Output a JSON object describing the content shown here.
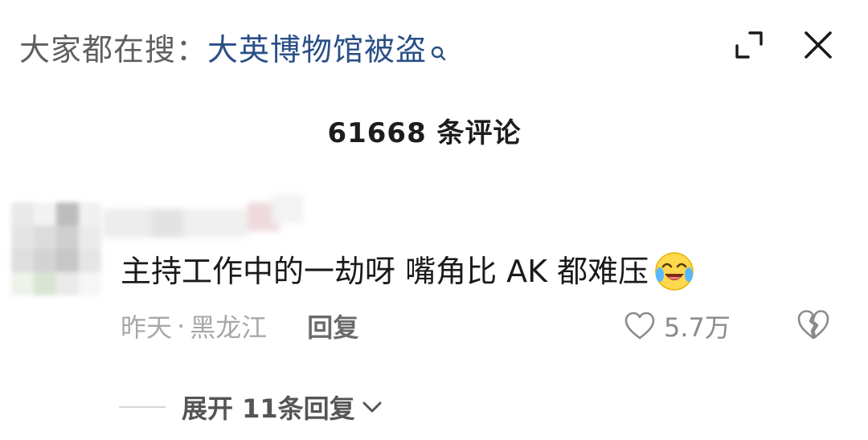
{
  "search_bar": {
    "prefix": "大家都在搜：",
    "term": "大英博物馆被盗"
  },
  "header": {
    "comment_count": "61668 条评论"
  },
  "comment": {
    "text": "主持工作中的一劫呀 嘴角比 AK 都难压",
    "emoji_icon": "crying-laughing-emoji-icon",
    "time": "昨天",
    "separator": "·",
    "location": "黑龙江",
    "reply_label": "回复",
    "likes": "5.7万"
  },
  "replies": {
    "expand_label": "展开 11条回复"
  },
  "colors": {
    "search_term": "#2a4f87",
    "text_primary": "#1a1a1a",
    "text_meta": "#a8a8a8"
  }
}
